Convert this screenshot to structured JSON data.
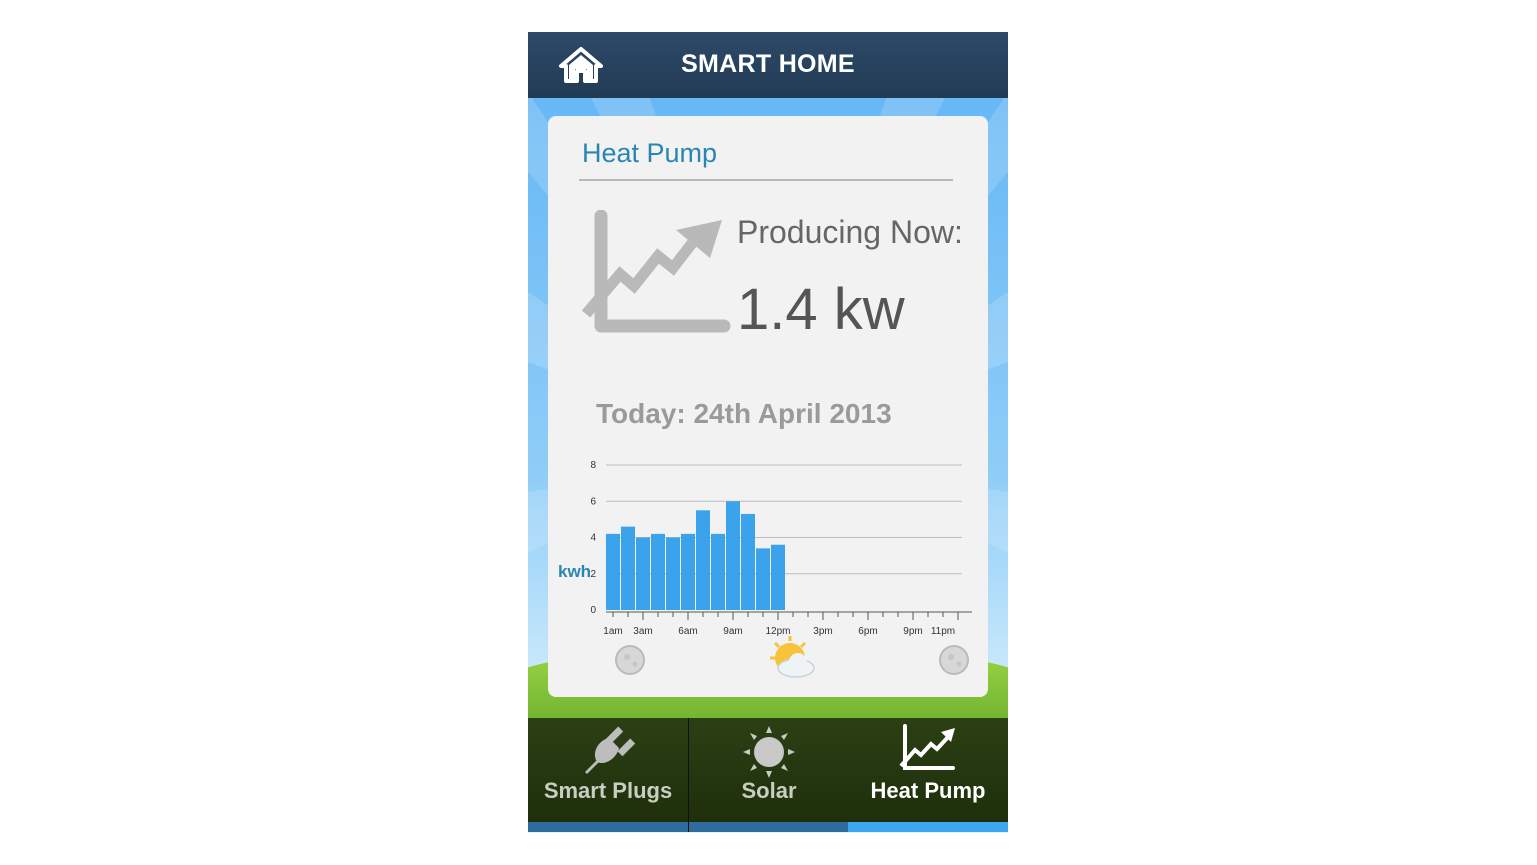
{
  "header": {
    "title": "SMART HOME",
    "home_icon": "home-icon"
  },
  "card": {
    "title": "Heat Pump",
    "icon": "trend-chart-icon",
    "producing_label": "Producing Now:",
    "producing_value": "1.4 kw",
    "today_label": "Today: 24th April 2013"
  },
  "chart_data": {
    "type": "bar",
    "ylabel": "kwh",
    "ylim": [
      0,
      8
    ],
    "yticks": [
      "0",
      "2",
      "4",
      "6",
      "8"
    ],
    "xtick_labels": [
      "1am",
      "3am",
      "6am",
      "9am",
      "12pm",
      "3pm",
      "6pm",
      "9pm",
      "11pm"
    ],
    "hours": [
      1,
      2,
      3,
      4,
      5,
      6,
      7,
      8,
      9,
      10,
      11,
      12
    ],
    "values": [
      4.2,
      4.6,
      4.0,
      4.2,
      4.0,
      4.2,
      5.5,
      4.2,
      6.0,
      5.3,
      3.4,
      3.6
    ],
    "bar_color": "#3ba2ec",
    "icons": [
      "moon-icon",
      "sun-cloud-icon",
      "moon-icon"
    ]
  },
  "nav": {
    "tabs": [
      {
        "label": "Smart Plugs",
        "icon": "plug-icon",
        "active": false
      },
      {
        "label": "Solar",
        "icon": "sun-icon",
        "active": false
      },
      {
        "label": "Heat Pump",
        "icon": "trend-chart-icon",
        "active": true
      }
    ]
  },
  "colors": {
    "header": "#2d4a67",
    "accent": "#2a86b0",
    "active_tab_bar": "#3aa7ee"
  }
}
